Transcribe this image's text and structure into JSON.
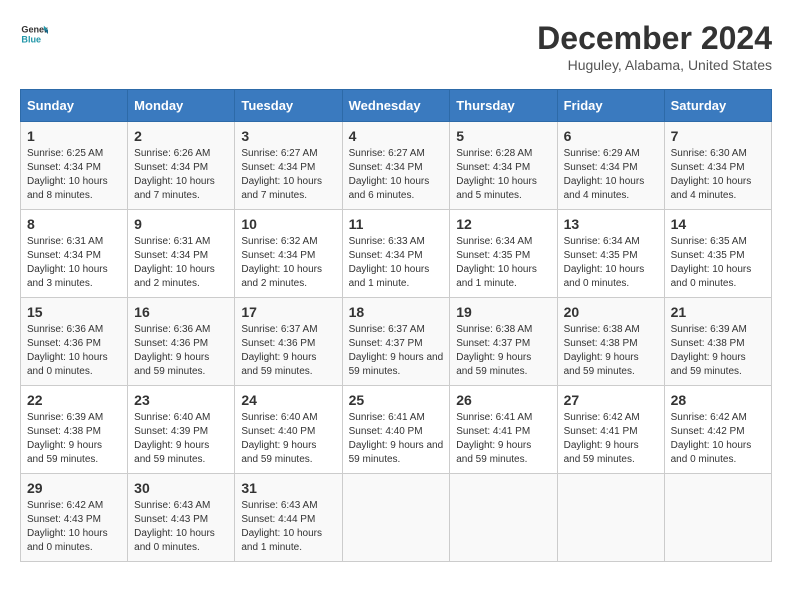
{
  "header": {
    "logo_line1": "General",
    "logo_line2": "Blue",
    "month": "December 2024",
    "location": "Huguley, Alabama, United States"
  },
  "weekdays": [
    "Sunday",
    "Monday",
    "Tuesday",
    "Wednesday",
    "Thursday",
    "Friday",
    "Saturday"
  ],
  "weeks": [
    [
      {
        "day": "1",
        "sunrise": "6:25 AM",
        "sunset": "4:34 PM",
        "daylight": "10 hours and 8 minutes."
      },
      {
        "day": "2",
        "sunrise": "6:26 AM",
        "sunset": "4:34 PM",
        "daylight": "10 hours and 7 minutes."
      },
      {
        "day": "3",
        "sunrise": "6:27 AM",
        "sunset": "4:34 PM",
        "daylight": "10 hours and 7 minutes."
      },
      {
        "day": "4",
        "sunrise": "6:27 AM",
        "sunset": "4:34 PM",
        "daylight": "10 hours and 6 minutes."
      },
      {
        "day": "5",
        "sunrise": "6:28 AM",
        "sunset": "4:34 PM",
        "daylight": "10 hours and 5 minutes."
      },
      {
        "day": "6",
        "sunrise": "6:29 AM",
        "sunset": "4:34 PM",
        "daylight": "10 hours and 4 minutes."
      },
      {
        "day": "7",
        "sunrise": "6:30 AM",
        "sunset": "4:34 PM",
        "daylight": "10 hours and 4 minutes."
      }
    ],
    [
      {
        "day": "8",
        "sunrise": "6:31 AM",
        "sunset": "4:34 PM",
        "daylight": "10 hours and 3 minutes."
      },
      {
        "day": "9",
        "sunrise": "6:31 AM",
        "sunset": "4:34 PM",
        "daylight": "10 hours and 2 minutes."
      },
      {
        "day": "10",
        "sunrise": "6:32 AM",
        "sunset": "4:34 PM",
        "daylight": "10 hours and 2 minutes."
      },
      {
        "day": "11",
        "sunrise": "6:33 AM",
        "sunset": "4:34 PM",
        "daylight": "10 hours and 1 minute."
      },
      {
        "day": "12",
        "sunrise": "6:34 AM",
        "sunset": "4:35 PM",
        "daylight": "10 hours and 1 minute."
      },
      {
        "day": "13",
        "sunrise": "6:34 AM",
        "sunset": "4:35 PM",
        "daylight": "10 hours and 0 minutes."
      },
      {
        "day": "14",
        "sunrise": "6:35 AM",
        "sunset": "4:35 PM",
        "daylight": "10 hours and 0 minutes."
      }
    ],
    [
      {
        "day": "15",
        "sunrise": "6:36 AM",
        "sunset": "4:36 PM",
        "daylight": "10 hours and 0 minutes."
      },
      {
        "day": "16",
        "sunrise": "6:36 AM",
        "sunset": "4:36 PM",
        "daylight": "9 hours and 59 minutes."
      },
      {
        "day": "17",
        "sunrise": "6:37 AM",
        "sunset": "4:36 PM",
        "daylight": "9 hours and 59 minutes."
      },
      {
        "day": "18",
        "sunrise": "6:37 AM",
        "sunset": "4:37 PM",
        "daylight": "9 hours and 59 minutes."
      },
      {
        "day": "19",
        "sunrise": "6:38 AM",
        "sunset": "4:37 PM",
        "daylight": "9 hours and 59 minutes."
      },
      {
        "day": "20",
        "sunrise": "6:38 AM",
        "sunset": "4:38 PM",
        "daylight": "9 hours and 59 minutes."
      },
      {
        "day": "21",
        "sunrise": "6:39 AM",
        "sunset": "4:38 PM",
        "daylight": "9 hours and 59 minutes."
      }
    ],
    [
      {
        "day": "22",
        "sunrise": "6:39 AM",
        "sunset": "4:38 PM",
        "daylight": "9 hours and 59 minutes."
      },
      {
        "day": "23",
        "sunrise": "6:40 AM",
        "sunset": "4:39 PM",
        "daylight": "9 hours and 59 minutes."
      },
      {
        "day": "24",
        "sunrise": "6:40 AM",
        "sunset": "4:40 PM",
        "daylight": "9 hours and 59 minutes."
      },
      {
        "day": "25",
        "sunrise": "6:41 AM",
        "sunset": "4:40 PM",
        "daylight": "9 hours and 59 minutes."
      },
      {
        "day": "26",
        "sunrise": "6:41 AM",
        "sunset": "4:41 PM",
        "daylight": "9 hours and 59 minutes."
      },
      {
        "day": "27",
        "sunrise": "6:42 AM",
        "sunset": "4:41 PM",
        "daylight": "9 hours and 59 minutes."
      },
      {
        "day": "28",
        "sunrise": "6:42 AM",
        "sunset": "4:42 PM",
        "daylight": "10 hours and 0 minutes."
      }
    ],
    [
      {
        "day": "29",
        "sunrise": "6:42 AM",
        "sunset": "4:43 PM",
        "daylight": "10 hours and 0 minutes."
      },
      {
        "day": "30",
        "sunrise": "6:43 AM",
        "sunset": "4:43 PM",
        "daylight": "10 hours and 0 minutes."
      },
      {
        "day": "31",
        "sunrise": "6:43 AM",
        "sunset": "4:44 PM",
        "daylight": "10 hours and 1 minute."
      },
      null,
      null,
      null,
      null
    ]
  ]
}
